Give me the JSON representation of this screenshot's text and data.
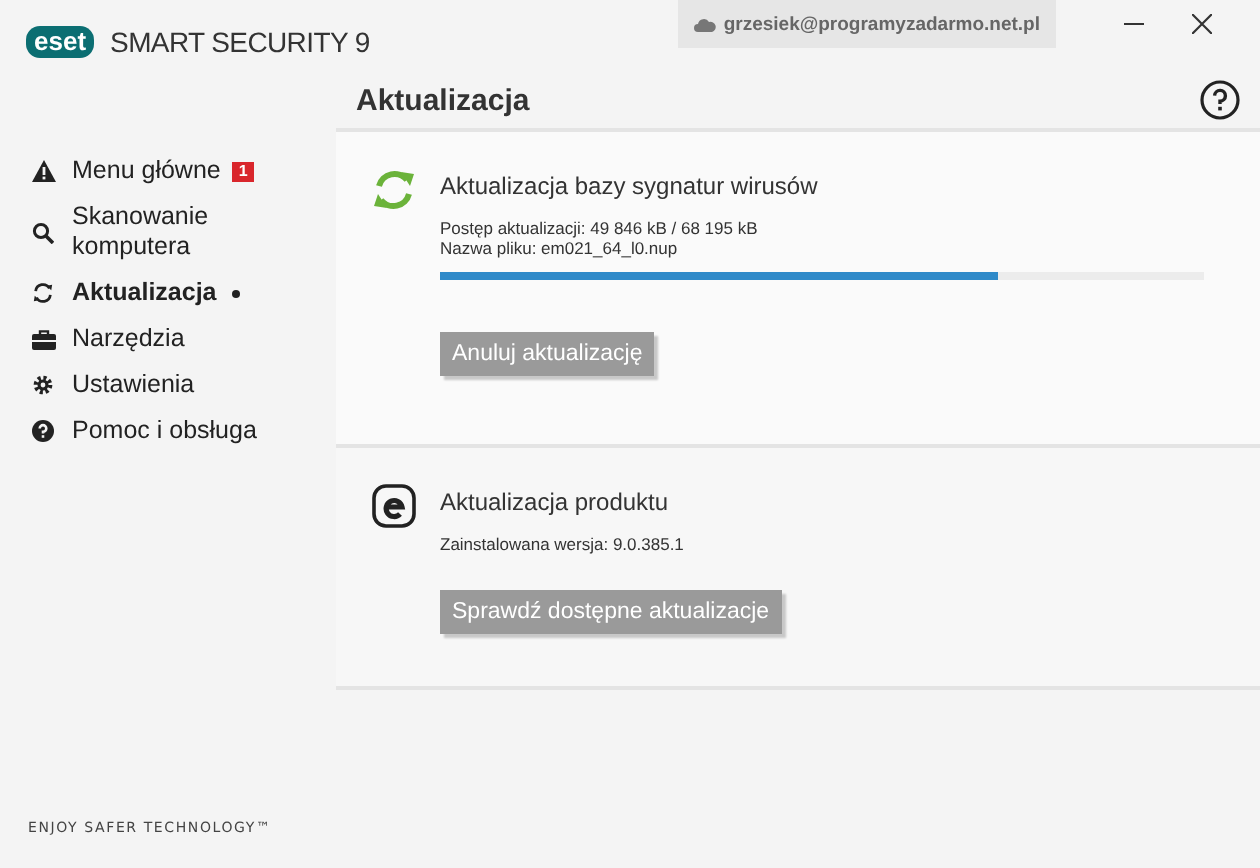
{
  "app": {
    "logo": "eset",
    "product": "SMART SECURITY 9",
    "account": "grzesiek@programyzadarmo.net.pl"
  },
  "sidebar": {
    "items": [
      {
        "label": "Menu główne",
        "kind": "warning",
        "selected": false,
        "badge": "1"
      },
      {
        "label": "Skanowanie komputera",
        "kind": "search",
        "selected": false
      },
      {
        "label": "Aktualizacja",
        "kind": "refresh",
        "selected": true
      },
      {
        "label": "Narzędzia",
        "kind": "toolbox",
        "selected": false
      },
      {
        "label": "Ustawienia",
        "kind": "gear",
        "selected": false
      },
      {
        "label": "Pomoc i obsługa",
        "kind": "help",
        "selected": false
      }
    ],
    "footer": "ENJOY SAFER TECHNOLOGY™"
  },
  "page": {
    "title": "Aktualizacja"
  },
  "sections": [
    {
      "kind": "progress",
      "title": "Aktualizacja bazy sygnatur wirusów",
      "lines": [
        "Postęp aktualizacji: 49 846 kB / 68 195 kB",
        "Nazwa pliku: em021_64_l0.nup"
      ],
      "level": 0.73,
      "button": "Anuluj aktualizację"
    },
    {
      "kind": "product",
      "title": "Aktualizacja produktu",
      "lines": [
        "Zainstalowana wersja: 9.0.385.1"
      ],
      "button": "Sprawdź dostępne aktualizacje"
    }
  ]
}
